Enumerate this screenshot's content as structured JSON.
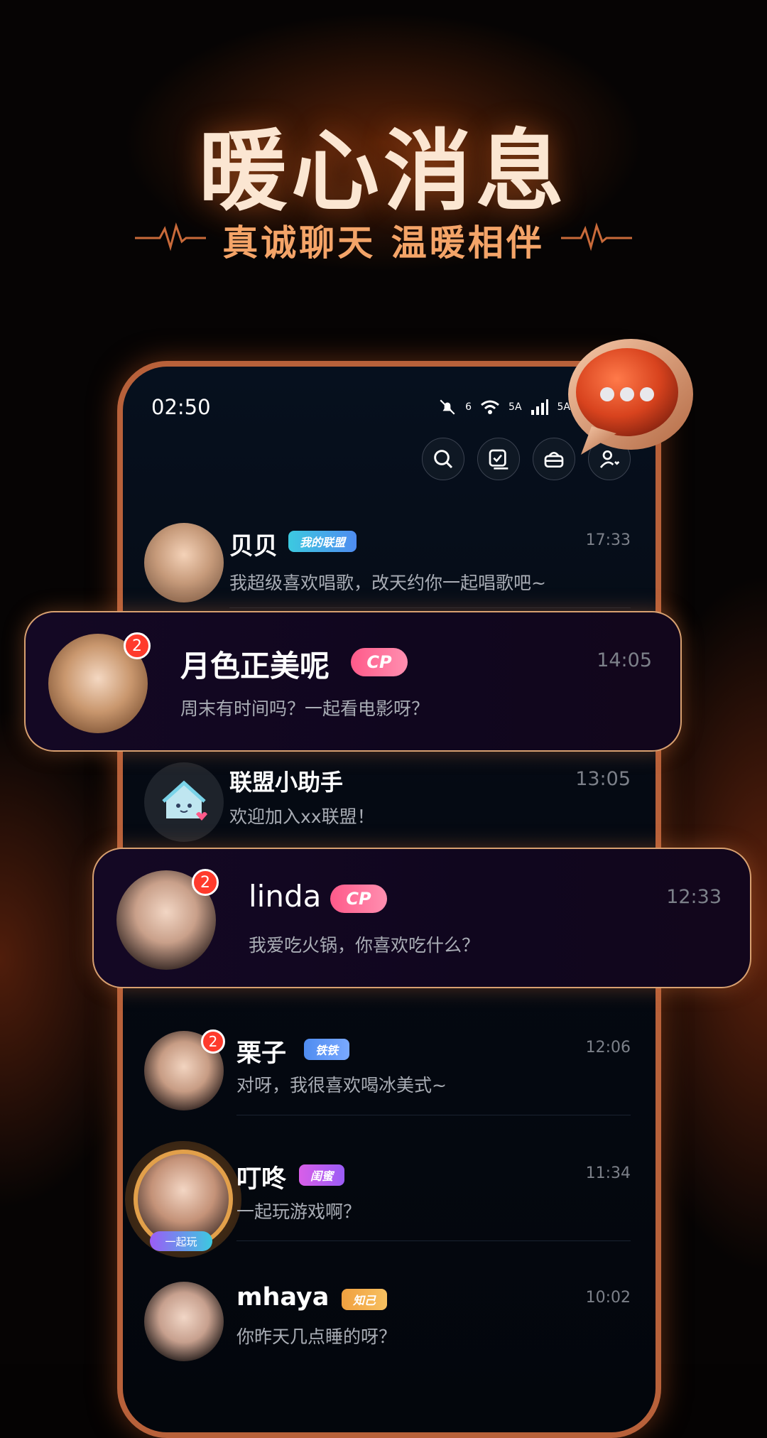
{
  "hero": {
    "headline": "暖心消息",
    "subline": "真诚聊天 温暖相伴"
  },
  "status_bar": {
    "time": "02:50",
    "network_1": "6",
    "network_2": "5A",
    "network_3": "5A"
  },
  "toolbar": {
    "icons": [
      "search-icon",
      "checklist-icon",
      "basket-icon",
      "add-friend-icon"
    ]
  },
  "chats": [
    {
      "name": "贝贝",
      "tag": "我的联盟",
      "time": "17:33",
      "message": "我超级喜欢唱歌，改天约你一起唱歌吧~",
      "badge": ""
    },
    {
      "name": "月色正美呢",
      "tag": "CP",
      "time": "14:05",
      "message": "周末有时间吗？一起看电影呀？",
      "badge": "2"
    },
    {
      "name": "联盟小助手",
      "tag": "",
      "time": "13:05",
      "message": "欢迎加入xx联盟！",
      "badge": ""
    },
    {
      "name": "linda",
      "tag": "CP",
      "time": "12:33",
      "message": "我爱吃火锅，你喜欢吃什么？",
      "badge": "2"
    },
    {
      "name": "栗子",
      "tag": "铁铁",
      "time": "12:06",
      "message": "对呀，我很喜欢喝冰美式~",
      "badge": "2"
    },
    {
      "name": "叮咚",
      "tag": "闺蜜",
      "time": "11:34",
      "message": "一起玩游戏啊？",
      "badge": "",
      "avatar_label": "一起玩"
    },
    {
      "name": "mhaya",
      "tag": "知己",
      "time": "10:02",
      "message": "你昨天几点睡的呀？",
      "badge": ""
    }
  ],
  "colors": {
    "accent": "#ff3b2c",
    "cp_tag": "#ff5a8a",
    "alliance_tag": "#3cc9e0",
    "tie_tag": "#4f8cf0",
    "gui_tag": "#d85ee8",
    "zhi_tag": "#f0a040"
  }
}
